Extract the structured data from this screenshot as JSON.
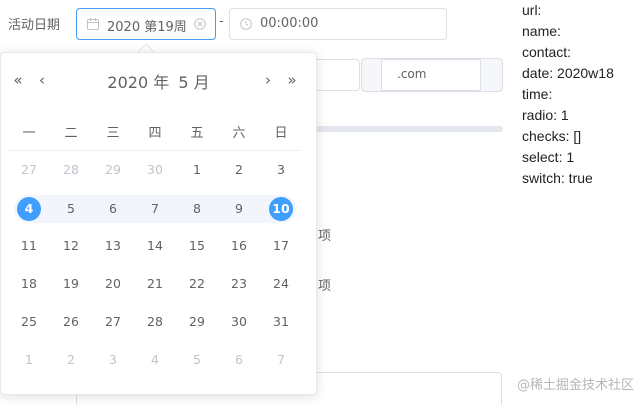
{
  "form": {
    "date_label": "活动日期",
    "week_value": "2020 第19周",
    "separator": "-",
    "time_value": "00:00:00",
    "url_suffix": ".com",
    "option_text_1": "项",
    "option_text_2": "项"
  },
  "picker": {
    "year_label": "2020 年",
    "month_label": "5 月",
    "prev_year": "«",
    "prev_month": "‹",
    "next_month": "›",
    "next_year": "»",
    "weekdays": [
      "一",
      "二",
      "三",
      "四",
      "五",
      "六",
      "日"
    ],
    "weeks": [
      [
        {
          "d": "27",
          "t": "prev"
        },
        {
          "d": "28",
          "t": "prev"
        },
        {
          "d": "29",
          "t": "prev"
        },
        {
          "d": "30",
          "t": "prev"
        },
        {
          "d": "1",
          "t": "cur"
        },
        {
          "d": "2",
          "t": "cur"
        },
        {
          "d": "3",
          "t": "cur"
        }
      ],
      [
        {
          "d": "4",
          "t": "sel"
        },
        {
          "d": "5",
          "t": "cur"
        },
        {
          "d": "6",
          "t": "cur"
        },
        {
          "d": "7",
          "t": "cur"
        },
        {
          "d": "8",
          "t": "cur"
        },
        {
          "d": "9",
          "t": "cur"
        },
        {
          "d": "10",
          "t": "sel"
        }
      ],
      [
        {
          "d": "11",
          "t": "cur"
        },
        {
          "d": "12",
          "t": "cur"
        },
        {
          "d": "13",
          "t": "cur"
        },
        {
          "d": "14",
          "t": "cur"
        },
        {
          "d": "15",
          "t": "cur"
        },
        {
          "d": "16",
          "t": "cur"
        },
        {
          "d": "17",
          "t": "cur"
        }
      ],
      [
        {
          "d": "18",
          "t": "cur"
        },
        {
          "d": "19",
          "t": "cur"
        },
        {
          "d": "20",
          "t": "cur"
        },
        {
          "d": "21",
          "t": "cur"
        },
        {
          "d": "22",
          "t": "cur"
        },
        {
          "d": "23",
          "t": "cur"
        },
        {
          "d": "24",
          "t": "cur"
        }
      ],
      [
        {
          "d": "25",
          "t": "cur"
        },
        {
          "d": "26",
          "t": "cur"
        },
        {
          "d": "27",
          "t": "cur"
        },
        {
          "d": "28",
          "t": "cur"
        },
        {
          "d": "29",
          "t": "cur"
        },
        {
          "d": "30",
          "t": "cur"
        },
        {
          "d": "31",
          "t": "cur"
        }
      ],
      [
        {
          "d": "1",
          "t": "next"
        },
        {
          "d": "2",
          "t": "next"
        },
        {
          "d": "3",
          "t": "next"
        },
        {
          "d": "4",
          "t": "next"
        },
        {
          "d": "5",
          "t": "next"
        },
        {
          "d": "6",
          "t": "next"
        },
        {
          "d": "7",
          "t": "next"
        }
      ]
    ],
    "accent_color": "#409eff"
  },
  "debug": {
    "lines": [
      "url:",
      "name:",
      "contact:",
      "date: 2020w18",
      "time:",
      "radio: 1",
      "checks: []",
      "select: 1",
      "switch: true"
    ]
  },
  "watermark": "@稀土掘金技术社区"
}
